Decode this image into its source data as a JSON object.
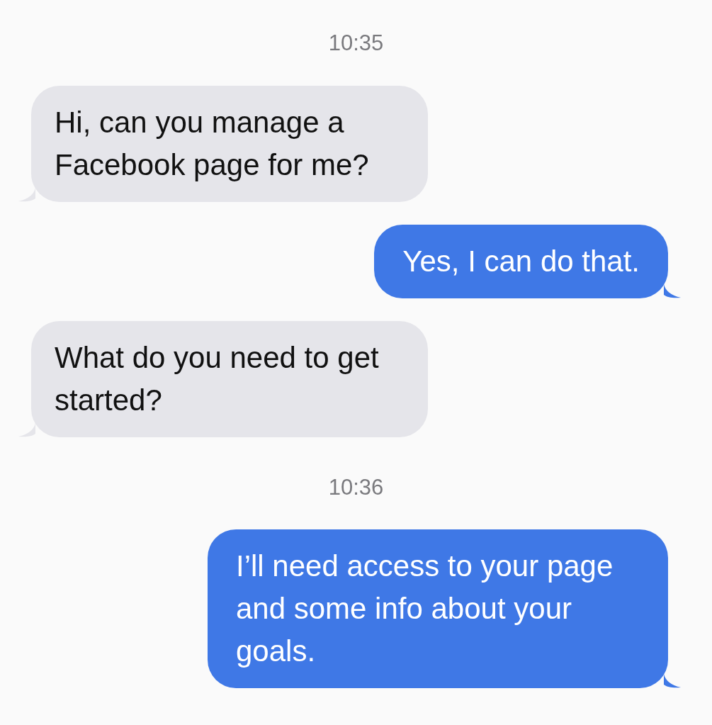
{
  "conversation": [
    {
      "kind": "time",
      "text": "10:35"
    },
    {
      "kind": "received",
      "text": "Hi, can you manage a Facebook page for me?"
    },
    {
      "kind": "sent",
      "text": "Yes, I can do that."
    },
    {
      "kind": "received",
      "text": "What do you need to get started?"
    },
    {
      "kind": "time",
      "text": "10:36"
    },
    {
      "kind": "sent",
      "text": "I’ll need access to your page and some info about your goals."
    }
  ]
}
